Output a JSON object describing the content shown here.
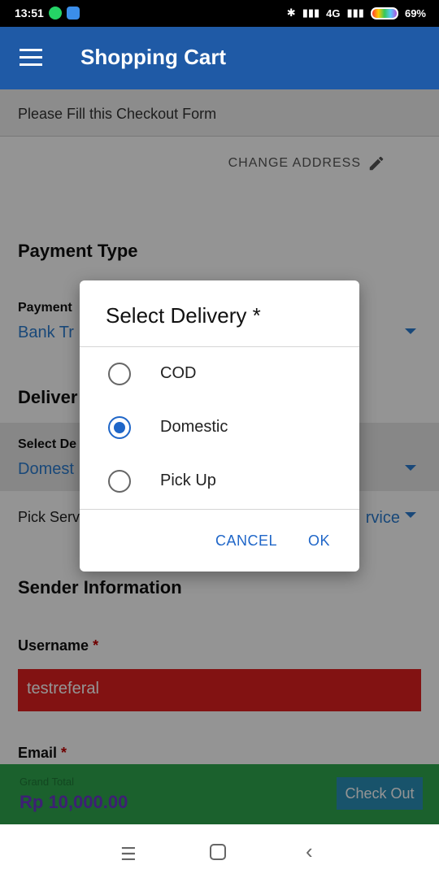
{
  "status_bar": {
    "time": "13:51",
    "right_text": "4G",
    "battery": "69%"
  },
  "app_bar": {
    "title": "Shopping Cart"
  },
  "form": {
    "header": "Please Fill this Checkout Form",
    "change_address": "CHANGE ADDRESS",
    "payment_section": "Payment Type",
    "payment_label": "Payment",
    "payment_value": "Bank Tr",
    "delivery_section": "Deliver",
    "select_delivery_label": "Select De",
    "select_delivery_value": "Domest",
    "pick_service_label": "Pick Serv",
    "pick_service_value": "rvice",
    "sender_section": "Sender Information",
    "username_label": "Username",
    "username_value": "testreferal",
    "email_label": "Email",
    "required_mark": "*"
  },
  "checkout_bar": {
    "total_label": "Grand Total",
    "total_value": "Rp 10,000.00",
    "button": "Check Out"
  },
  "dialog": {
    "title": "Select Delivery *",
    "options": [
      {
        "label": "COD",
        "selected": false
      },
      {
        "label": "Domestic",
        "selected": true
      },
      {
        "label": "Pick Up",
        "selected": false
      }
    ],
    "cancel": "CANCEL",
    "ok": "OK"
  },
  "colors": {
    "app_bar": "#1f5aa6",
    "accent": "#1f66c8",
    "checkout_bar": "#2fa84f",
    "error_input": "#e02020"
  },
  "icons": {
    "menu": "hamburger-icon",
    "edit": "pencil-icon",
    "nav_menu": "menu-lines-icon",
    "nav_home": "square-icon",
    "nav_back": "back-chevron-icon"
  }
}
